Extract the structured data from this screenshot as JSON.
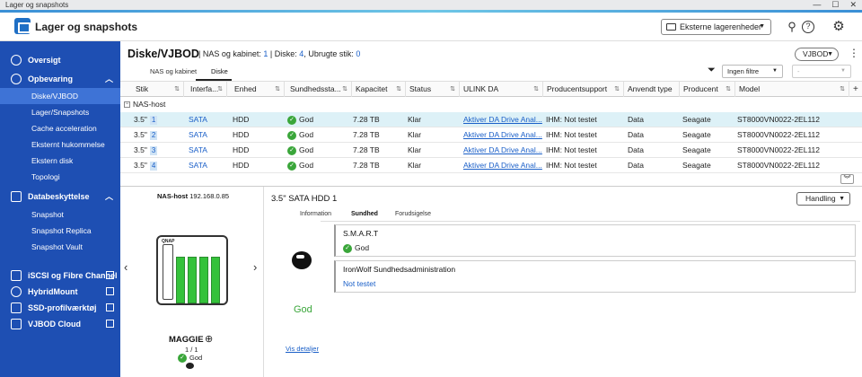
{
  "window": {
    "title": "Lager og snapshots",
    "min": "—",
    "max": "☐",
    "close": "✕"
  },
  "app": {
    "title": "Lager og snapshots",
    "external_button": "Eksterne lagerenheder"
  },
  "sidebar": {
    "oversigt": "Oversigt",
    "opbevaring": "Opbevaring",
    "sub": [
      "Diske/VJBOD",
      "Lager/Snapshots",
      "Cache acceleration",
      "Eksternt hukommelse",
      "Ekstern disk",
      "Topologi"
    ],
    "databeskyttelse": "Databeskyttelse",
    "sub2": [
      "Snapshot",
      "Snapshot Replica",
      "Snapshot Vault"
    ],
    "ext": [
      "iSCSI og Fibre Channel",
      "HybridMount",
      "SSD-profilværktøj",
      "VJBOD Cloud"
    ]
  },
  "page": {
    "title": "Diske/VJBOD",
    "stats_label1": "NAS og kabinet:",
    "stats_val1": "1",
    "stats_label2": "Diske:",
    "stats_val2": "4",
    "stats_label3": ", Ubrugte stik:",
    "stats_val3": "0",
    "vjbod_button": "VJBOD"
  },
  "tabs": [
    "NAS og kabinet",
    "Diske"
  ],
  "filter": {
    "selected": "Ingen filtre",
    "second": "-"
  },
  "columns": [
    "Stik",
    "Interfa...",
    "Enhed",
    "Sundhedssta...",
    "Kapacitet",
    "Status",
    "ULINK DA",
    "Producentsupport",
    "Anvendt type",
    "Producent",
    "Model"
  ],
  "group": "NAS-host",
  "rows": [
    {
      "slot": "3.5\"",
      "num": "1",
      "iface": "SATA",
      "unit": "HDD",
      "health": "God",
      "cap": "7.28 TB",
      "status": "Klar",
      "ulink": "Aktiver DA Drive Anal...",
      "support": "IHM: Not testet",
      "type": "Data",
      "vendor": "Seagate",
      "model": "ST8000VN0022-2EL112"
    },
    {
      "slot": "3.5\"",
      "num": "2",
      "iface": "SATA",
      "unit": "HDD",
      "health": "God",
      "cap": "7.28 TB",
      "status": "Klar",
      "ulink": "Aktiver DA Drive Anal...",
      "support": "IHM: Not testet",
      "type": "Data",
      "vendor": "Seagate",
      "model": "ST8000VN0022-2EL112"
    },
    {
      "slot": "3.5\"",
      "num": "3",
      "iface": "SATA",
      "unit": "HDD",
      "health": "God",
      "cap": "7.28 TB",
      "status": "Klar",
      "ulink": "Aktiver DA Drive Anal...",
      "support": "IHM: Not testet",
      "type": "Data",
      "vendor": "Seagate",
      "model": "ST8000VN0022-2EL112"
    },
    {
      "slot": "3.5\"",
      "num": "4",
      "iface": "SATA",
      "unit": "HDD",
      "health": "God",
      "cap": "7.28 TB",
      "status": "Klar",
      "ulink": "Aktiver DA Drive Anal...",
      "support": "IHM: Not testet",
      "type": "Data",
      "vendor": "Seagate",
      "model": "ST8000VN0022-2EL112"
    }
  ],
  "device": {
    "host_label": "NAS-host",
    "ip": "192.168.0.85",
    "brand": "QNAP",
    "name": "MAGGIE",
    "count": "1 / 1",
    "status": "God"
  },
  "detail": {
    "title": "3.5\" SATA HDD 1",
    "button": "Handling",
    "tabs": [
      "Information",
      "Sundhed",
      "Forudsigelse"
    ],
    "overall": "God",
    "smart_title": "S.M.A.R.T",
    "smart_value": "God",
    "ironwolf_title": "IronWolf Sundhedsadministration",
    "ironwolf_value": "Not testet",
    "link": "Vis detaljer"
  }
}
